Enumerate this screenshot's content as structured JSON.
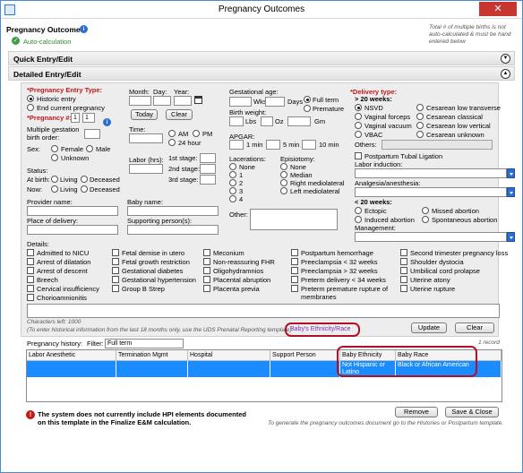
{
  "window": {
    "title": "Pregnancy Outcomes",
    "close_label": "✕"
  },
  "header": {
    "label": "Pregnancy Outcome:",
    "autocalc": "Auto-calculation",
    "note": "Total # of multiple births is not auto-calculated & must be hand entered below"
  },
  "sections": {
    "quick": "Quick Entry/Edit",
    "detailed": "Detailed Entry/Edit"
  },
  "entry": {
    "entry_type_label": "*Pregnancy Entry Type:",
    "historic": "Historic entry",
    "end_current": "End current pregnancy",
    "pregnancy_num_label": "*Pregnancy #:",
    "pregnancy_num_value": "1",
    "pregnancy_num_total": "1",
    "multi_label": "Multiple gestation birth order:",
    "sex_label": "Sex:",
    "female": "Female",
    "male": "Male",
    "unknown": "Unknown",
    "status_label": "Status:",
    "at_birth": "At birth:",
    "now": "Now:",
    "living": "Living",
    "deceased": "Deceased"
  },
  "date": {
    "month": "Month:",
    "day": "Day:",
    "year": "Year:",
    "today": "Today",
    "clear": "Clear",
    "time": "Time:",
    "am": "AM",
    "pm": "PM",
    "h24": "24 hour",
    "labor_hrs": "Labor (hrs):",
    "stage1": "1st stage:",
    "stage2": "2nd stage:",
    "stage3": "3rd stage:"
  },
  "gest": {
    "age": "Gestational age:",
    "wks": "Wks",
    "days": "Days",
    "full": "Full term",
    "premature": "Premature",
    "weight": "Birth weight:",
    "lbs": "Lbs",
    "oz": "Oz",
    "gm": "Gm",
    "apgar": "APGAR:",
    "min1": "1 min",
    "min5": "5 min",
    "min10": "10 min",
    "lacerations": "Lacerations:",
    "lac": [
      "None",
      "1",
      "2",
      "3",
      "4"
    ],
    "episiotomy": "Episiotomy:",
    "epi": [
      "None",
      "Median",
      "Right mediolateral",
      "Left mediolateral"
    ],
    "other": "Other:"
  },
  "delivery": {
    "type_label": "*Delivery type:",
    "gt20": "> 20 weeks:",
    "left": [
      "NSVD",
      "Vaginal forceps",
      "Vaginal vacuum",
      "VBAC"
    ],
    "right": [
      "Cesarean low transverse",
      "Cesarean classical",
      "Cesarean low vertical",
      "Cesarean unknown"
    ],
    "others": "Others:",
    "tubal": "Postpartum Tubal Ligation",
    "induction": "Labor induction:",
    "analgesia": "Analgesia/anesthesia:",
    "lt20": "< 20 weeks:",
    "lt20_opts": [
      "Ectopic",
      "Missed abortion",
      "Induced abortion",
      "Spontaneous abortion"
    ],
    "management": "Management:"
  },
  "names": {
    "provider": "Provider name:",
    "baby": "Baby name:",
    "place": "Place of delivery:",
    "support": "Supporting person(s):"
  },
  "details": {
    "label": "Details:",
    "col1": [
      "Admitted to NICU",
      "Arrest of dilatation",
      "Arrest of descent",
      "Breech",
      "Cervical insufficiency",
      "Chorioamnionitis"
    ],
    "col2": [
      "Fetal demise in utero",
      "Fetal growth restriction",
      "Gestational diabetes",
      "Gestational hypertension",
      "Group B Strep"
    ],
    "col3": [
      "Meconium",
      "Non-reassuring FHR",
      "Oligohydramnios",
      "Placental abruption",
      "Placenta previa"
    ],
    "col4": [
      "Postpartum hemorrhage",
      "Preeclampsia < 32 weeks",
      "Preeclampsia > 32 weeks",
      "Preterm delivery < 34 weeks",
      "Preterm premature rupture of membranes"
    ],
    "col5": [
      "Second trimester pregnancy loss",
      "Shoulder dystocia",
      "Umbilical cord prolapse",
      "Uterine atony",
      "Uterine rupture"
    ]
  },
  "footer": {
    "chars_left": "Characters left: 1000",
    "hint": "(To enter historical information from the last 18 months only, use the UDS Prenatal Reporting template)",
    "ethnicity_link": "Baby's Ethnicity/Race",
    "update": "Update",
    "clear": "Clear"
  },
  "history": {
    "label": "Pregnancy history:",
    "filter_label": "Filter:",
    "filter_value": "Full term",
    "count": "1 record",
    "columns": [
      "Labor Anesthetic",
      "Termination Mgmt",
      "Hospital",
      "Support Person",
      "Baby Ethnicity",
      "Baby Race"
    ],
    "row": [
      "",
      "",
      "",
      "",
      "Not Hispanic or Latino",
      "Black or African American"
    ]
  },
  "bottom": {
    "warning": "The system does not currently include HPI elements documented on this template in the Finalize E&M calculation.",
    "remove": "Remove",
    "save_close": "Save & Close",
    "generate_hint": "To generate the pregnancy outcomes document go to the Histories or Postpartum template."
  },
  "colors": {
    "accent": "#1a8cff",
    "required": "#c21818",
    "highlight": "#b2102a"
  }
}
